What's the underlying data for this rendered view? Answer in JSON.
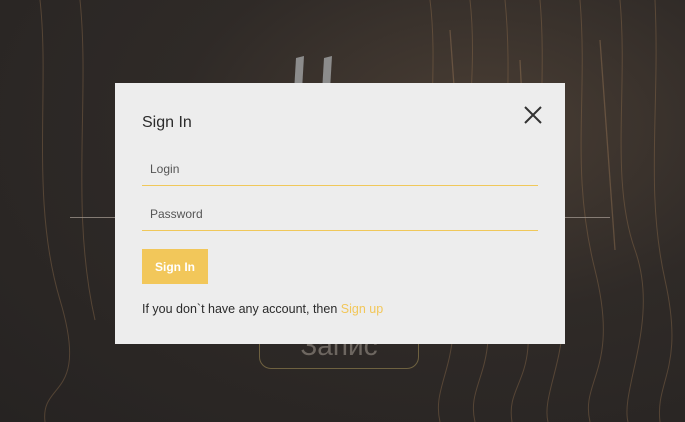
{
  "background": {
    "button_label": "Запис",
    "accent_color": "#f2c75a"
  },
  "modal": {
    "title": "Sign In",
    "close_icon": "close-icon",
    "login_placeholder": "Login",
    "password_placeholder": "Password",
    "submit_label": "Sign In",
    "footer_text": "If you don`t have any account, then ",
    "signup_label": "Sign up",
    "field_underline_color": "#f0c85a",
    "button_color": "#f2c75a"
  }
}
